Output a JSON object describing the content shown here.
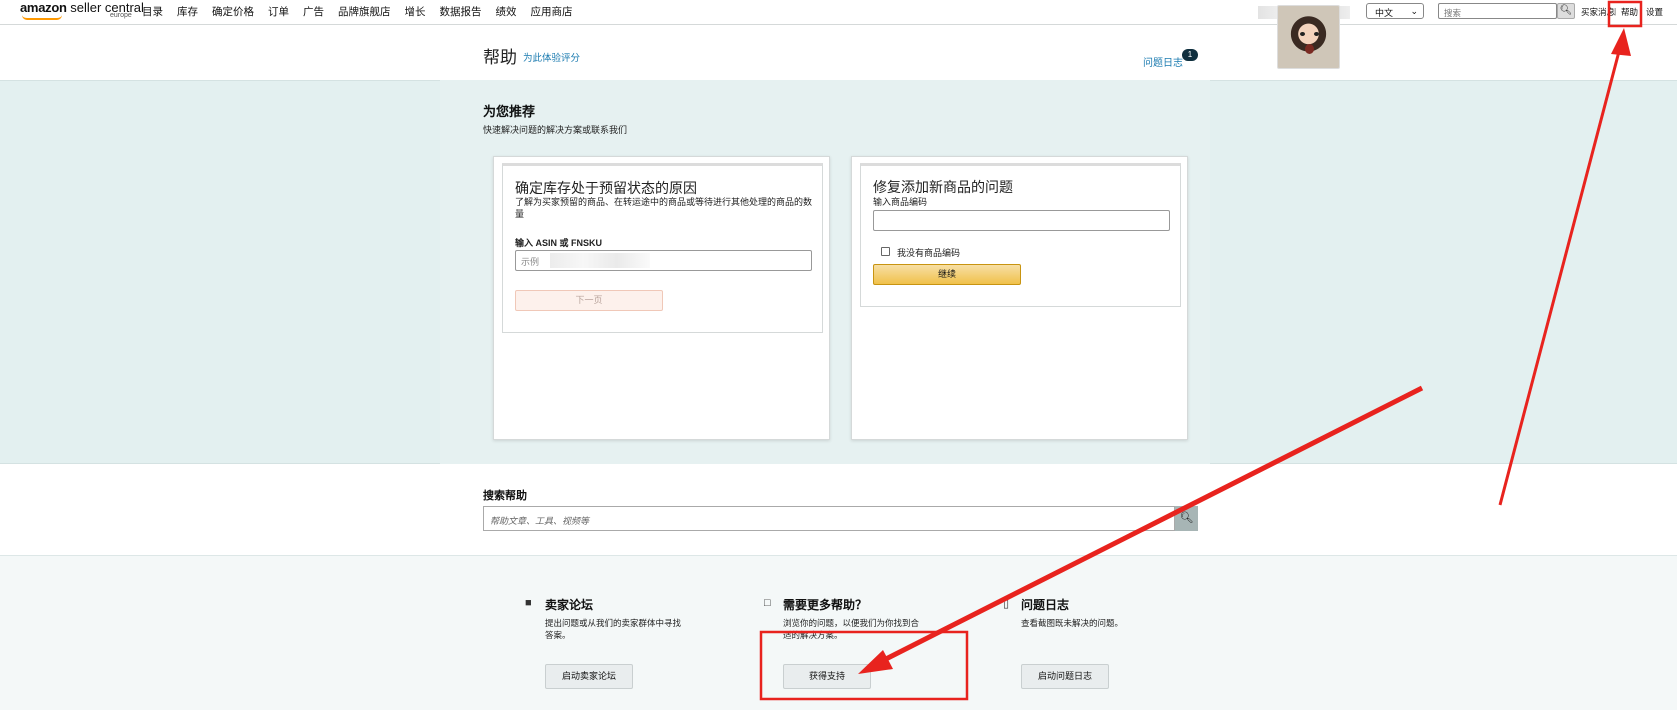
{
  "topnav": {
    "logo_brand": "amazon",
    "logo_rest": " seller central",
    "logo_region": "europe",
    "menu": [
      "目录",
      "库存",
      "确定价格",
      "订单",
      "广告",
      "品牌旗舰店",
      "增长",
      "数据报告",
      "绩效",
      "应用商店"
    ],
    "language": "中文",
    "search_placeholder": "搜索",
    "link_messages": "买家消息",
    "link_sep": "|",
    "link_help": "帮助",
    "link_settings": "设置"
  },
  "header": {
    "title": "帮助",
    "rate_link": "为此体验评分",
    "issue_log_link": "问题日志",
    "issue_count": "1"
  },
  "recommend": {
    "title": "为您推荐",
    "subtitle": "快速解决问题的解决方案或联系我们",
    "card1": {
      "title": "确定库存处于预留状态的原因",
      "desc": "了解为买家预留的商品、在转运途中的商品或等待进行其他处理的商品的数量",
      "label": "输入 ASIN 或 FNSKU",
      "input_placeholder": "示例",
      "button": "下一页"
    },
    "card2": {
      "title": "修复添加新商品的问题",
      "label": "输入商品编码",
      "checkbox_label": "我没有商品编码",
      "button": "继续"
    }
  },
  "search_help": {
    "title": "搜索帮助",
    "placeholder": "帮助文章、工具、视频等"
  },
  "bottom": {
    "forum": {
      "title": "卖家论坛",
      "desc": "提出问题或从我们的卖家群体中寻找答案。",
      "button": "启动卖家论坛"
    },
    "more_help": {
      "title": "需要更多帮助？",
      "desc": "浏览你的问题，以便我们为你找到合适的解决方案。",
      "button": "获得支持"
    },
    "issue_log": {
      "title": "问题日志",
      "desc": "查看截图既未解决的问题。",
      "button": "启动问题日志"
    }
  },
  "colors": {
    "link": "#1b7bb0",
    "band": "#e3f0f0",
    "primary_button": "#f0c14b",
    "annotation": "#e8231e"
  },
  "icons": {
    "search": "magnifier-icon",
    "forum": "chat-bubbles-icon",
    "more_help": "speech-bubble-icon",
    "issue_log": "document-icon"
  }
}
